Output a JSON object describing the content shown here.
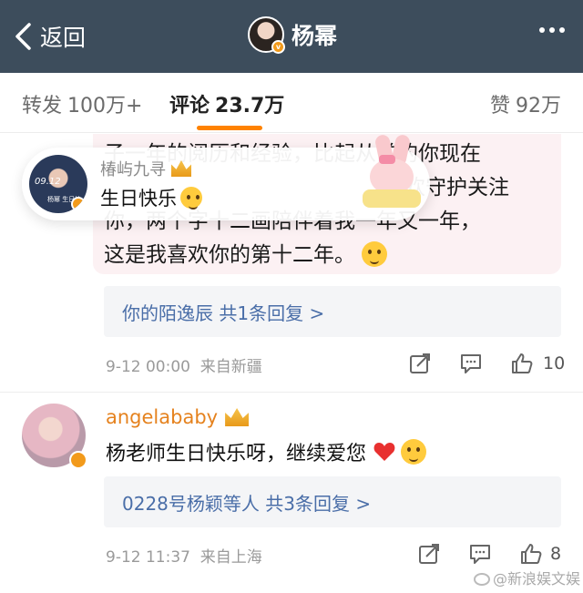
{
  "header": {
    "back_label": "返回",
    "title": "杨幂",
    "more_icon": "more-dots-icon"
  },
  "tabs": {
    "repost_label": "转发",
    "repost_count": "100万+",
    "comment_label": "评论",
    "comment_count": "23.7万",
    "like_label": "赞",
    "like_count": "92万",
    "active": "comment",
    "accent_color": "#ff8200"
  },
  "comment1": {
    "text": "子一年的阅历和经验，比起从前的你现在",
    "text_line2": "欢守护关注",
    "text_line3": "你，两个字十二画陪伴着我一年又一年，",
    "text_line4": "这是我喜欢你的第十二年。",
    "reply_summary": "你的陌逸辰  共1条回复 >",
    "time": "9-12 00:00",
    "source": "来自新疆",
    "like_count": "10"
  },
  "floating_card": {
    "name": "椿屿九寻",
    "text": "生日快乐",
    "avatar_text_1": "09.12",
    "avatar_text_2": "杨幂 生日快"
  },
  "comment2": {
    "name": "angelababy",
    "text": "杨老师生日快乐呀，继续爱您",
    "reply_summary": "0228号杨颖等人  共3条回复 >",
    "time": "9-12 11:37",
    "source": "来自上海",
    "like_count": "8"
  },
  "watermark": "@新浪娱文娱",
  "colors": {
    "header_bg": "#3d4d5c",
    "link": "#4a6ea8",
    "vip_name": "#e5821e",
    "highlight_bg": "#fcf1f3"
  }
}
